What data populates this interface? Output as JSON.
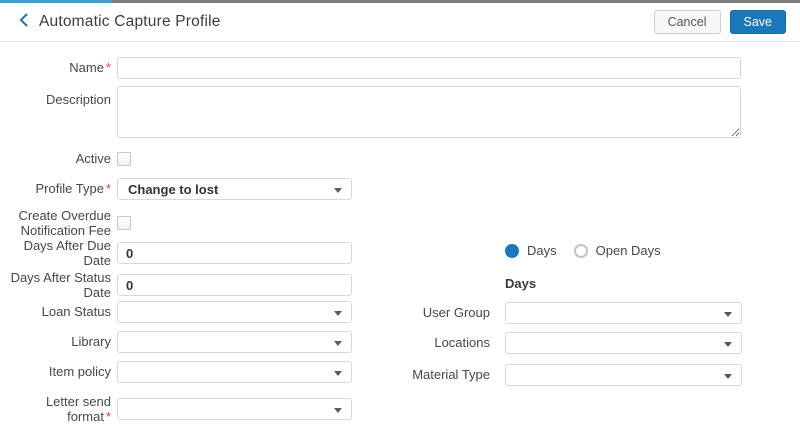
{
  "colors": {
    "accent_blue": "#1a77ba",
    "topbar_accent": "#449bd5",
    "required_red": "#e04343"
  },
  "header": {
    "title": "Automatic Capture Profile",
    "cancel_label": "Cancel",
    "save_label": "Save"
  },
  "form": {
    "required_marker": "*",
    "fields": {
      "name": {
        "label": "Name",
        "required": true,
        "value": ""
      },
      "description": {
        "label": "Description",
        "value": ""
      },
      "active": {
        "label": "Active",
        "checked": false
      },
      "profile_type": {
        "label": "Profile Type",
        "required": true,
        "value": "Change to lost"
      },
      "create_overdue_notification_fee": {
        "label": "Create Overdue Notification Fee",
        "checked": false
      },
      "days_after_due_date": {
        "label": "Days After Due Date",
        "value": "0"
      },
      "days_after_status_date": {
        "label": "Days After Status Date",
        "value": "0"
      },
      "loan_status": {
        "label": "Loan Status",
        "value": ""
      },
      "library": {
        "label": "Library",
        "value": ""
      },
      "item_policy": {
        "label": "Item policy",
        "value": ""
      },
      "letter_send_format": {
        "label": "Letter send format",
        "required": true,
        "value": ""
      },
      "user_group": {
        "label": "User Group",
        "value": ""
      },
      "locations": {
        "label": "Locations",
        "value": ""
      },
      "material_type": {
        "label": "Material Type",
        "value": ""
      }
    },
    "day_type": {
      "options": [
        {
          "label": "Days",
          "selected": true
        },
        {
          "label": "Open Days",
          "selected": false
        }
      ],
      "section_heading": "Days"
    }
  }
}
